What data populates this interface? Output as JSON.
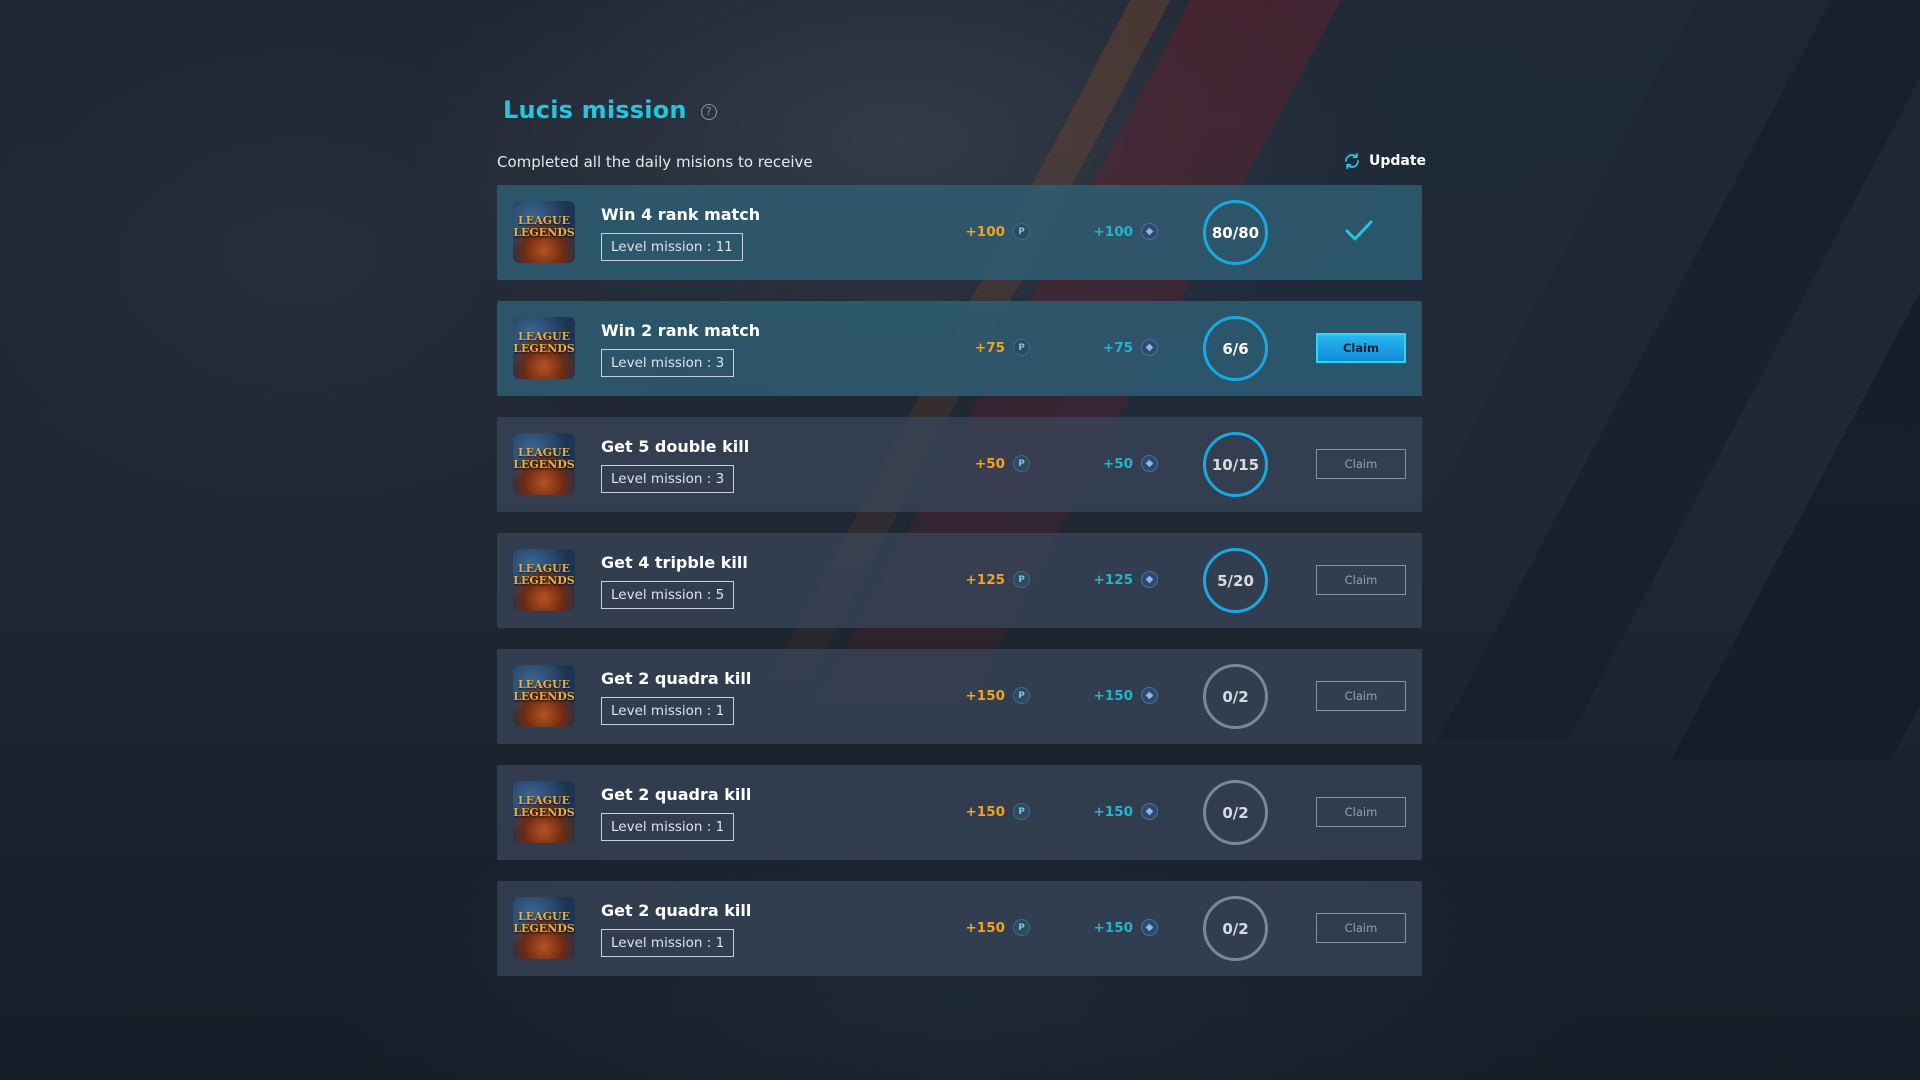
{
  "header": {
    "title": "Lucis mission",
    "subtitle": "Completed all the daily misions to receive",
    "update_label": "Update"
  },
  "colors": {
    "accent": "#22c7df",
    "points": "#f0a31e",
    "gems": "#22b5cd",
    "progress_ring": "#1aa8e0"
  },
  "missions": [
    {
      "name": "Win 4 rank match",
      "level": "Level mission :  11",
      "points": "+100",
      "gems": "+100",
      "progress": "80/80",
      "status": "claimed"
    },
    {
      "name": "Win 2 rank match",
      "level": "Level mission :  3",
      "points": "+75",
      "gems": "+75",
      "progress": "6/6",
      "claim_label": "Claim",
      "status": "claimable"
    },
    {
      "name": "Get 5 double kill",
      "level": "Level mission :  3",
      "points": "+50",
      "gems": "+50",
      "progress": "10/15",
      "claim_label": "Claim",
      "status": "in-progress"
    },
    {
      "name": "Get 4 tripble kill",
      "level": "Level mission :  5",
      "points": "+125",
      "gems": "+125",
      "progress": "5/20",
      "claim_label": "Claim",
      "status": "in-progress"
    },
    {
      "name": "Get 2 quadra kill",
      "level": "Level mission :  1",
      "points": "+150",
      "gems": "+150",
      "progress": "0/2",
      "claim_label": "Claim",
      "status": "not-started"
    },
    {
      "name": "Get 2 quadra kill",
      "level": "Level mission :  1",
      "points": "+150",
      "gems": "+150",
      "progress": "0/2",
      "claim_label": "Claim",
      "status": "not-started"
    },
    {
      "name": "Get 2 quadra kill",
      "level": "Level mission :  1",
      "points": "+150",
      "gems": "+150",
      "progress": "0/2",
      "claim_label": "Claim",
      "status": "not-started"
    }
  ],
  "game_logo_text": "LEAGUE LEGENDS",
  "points_icon_text": "P"
}
